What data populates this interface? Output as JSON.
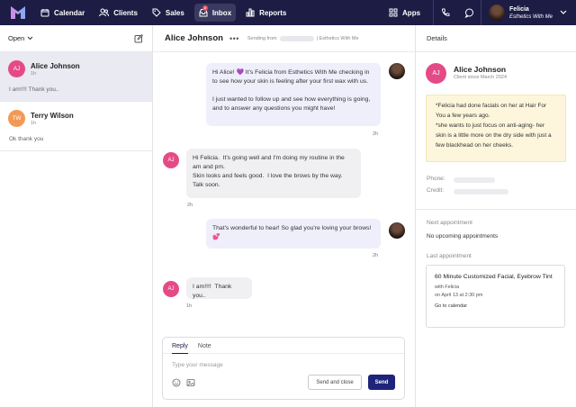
{
  "nav": {
    "items": [
      {
        "label": "Calendar",
        "icon": "calendar-icon"
      },
      {
        "label": "Clients",
        "icon": "users-icon"
      },
      {
        "label": "Sales",
        "icon": "tag-icon"
      },
      {
        "label": "Inbox",
        "icon": "inbox-icon",
        "active": true,
        "badge": "2"
      },
      {
        "label": "Reports",
        "icon": "bar-chart-icon"
      }
    ],
    "apps_label": "Apps",
    "user": {
      "name": "Felicia",
      "business": "Esthetics With Me"
    },
    "colors": {
      "background": "#1c1c45",
      "active": "#3a3a60"
    }
  },
  "inbox": {
    "filter_label": "Open",
    "conversations": [
      {
        "initials": "AJ",
        "name": "Alice Johnson",
        "time": "1h",
        "preview": "I am!!!! Thank you..",
        "color": "#e44b86",
        "selected": true
      },
      {
        "initials": "TW",
        "name": "Terry Wilson",
        "time": "1h",
        "preview": "Ok thank you",
        "color": "#f29a55",
        "selected": false
      }
    ]
  },
  "thread": {
    "contact_name": "Alice Johnson",
    "more": "•••",
    "sending_from_label": "Sending from",
    "business": "| Esthetics With Me",
    "messages": [
      {
        "direction": "out",
        "text": "Hi Alice! 💜 It's Felicia from Esthetics With Me checking in to see how your skin is feeling after your first wax with us.\n\nI just wanted to follow up and see how everything is going, and to answer any questions you might have!",
        "time": "2h"
      },
      {
        "direction": "in",
        "initials": "AJ",
        "text": "Hi Felicia.  It's going well and I'm doing my routine in the am and pm.\nSkin looks and feels good.  I love the brows by the way. Talk soon.",
        "time": "2h"
      },
      {
        "direction": "out",
        "text": "That's wonderful to hear! So glad you're loving your brows! 💕",
        "time": "2h"
      },
      {
        "direction": "in",
        "initials": "AJ",
        "text": "I am!!!!  Thank you..",
        "time": "1h"
      }
    ],
    "composer": {
      "tabs": [
        "Reply",
        "Note"
      ],
      "placeholder": "Type your message",
      "send_close_label": "Send and close",
      "send_label": "Send"
    }
  },
  "details": {
    "title": "Details",
    "initials": "AJ",
    "name": "Alice Johnson",
    "since": "Client since March 2024",
    "note": "*Felicia had done facials on her at Hair For You a few years ago.\n*she wants to just focus on anti-aging- her skin is a little more on the dry side with just a few blackhead on her cheeks.",
    "phone_label": "Phone:",
    "credit_label": "Credit:",
    "next_label": "Next appointment",
    "next_value": "No upcoming appointments",
    "last_label": "Last appointment",
    "last_appt": {
      "title": "60 Minute Customized Facial, Eyebrow Tint",
      "with": "with Felicia",
      "when": "on April 13 at 2:30 pm",
      "link": "Go to calendar"
    },
    "note_color": "#fdf6dc"
  }
}
